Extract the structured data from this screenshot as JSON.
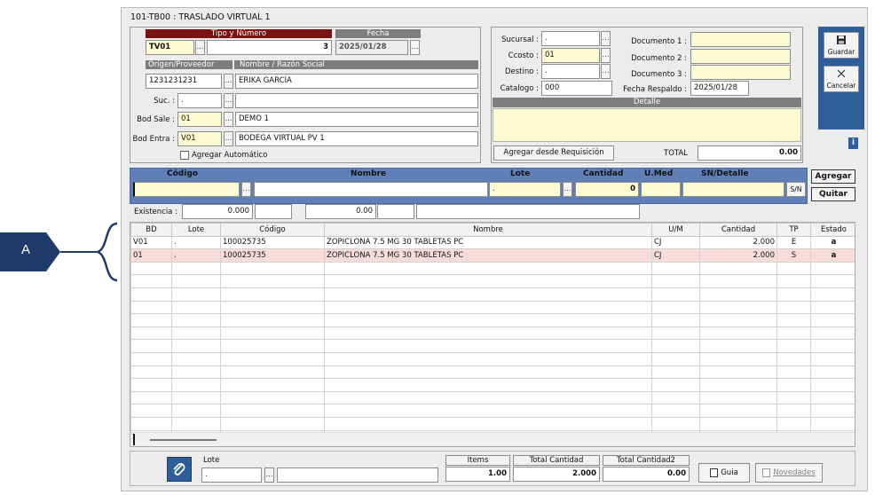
{
  "window_title": "101-TB00 : TRASLADO VIRTUAL 1",
  "callout": "A",
  "header": {
    "tipo_numero_label": "Tipo y Número",
    "fecha_label": "Fecha",
    "tipo": "TV01",
    "numero": "3",
    "fecha": "2025/01/28",
    "origen_label": "Origen/Proveedor",
    "nombre_label": "Nombre / Razón Social",
    "origen": "1231231231",
    "nombre": "ERIKA GARCÍA",
    "suc_label": "Suc. :",
    "suc": ".",
    "bod_sale_label": "Bod Sale :",
    "bod_sale": "01",
    "bod_sale_name": "DEMO 1",
    "bod_entra_label": "Bod Entra :",
    "bod_entra": "V01",
    "bod_entra_name": "BODEGA VIRTUAL PV 1",
    "agregar_auto_label": "Agregar Automático"
  },
  "right_panel": {
    "sucursal_label": "Sucursal :",
    "sucursal": ".",
    "ccosto_label": "Ccosto :",
    "ccosto": "01",
    "destino_label": "Destino :",
    "destino": ".",
    "catalogo_label": "Catalogo :",
    "catalogo": "000",
    "doc1_label": "Documento 1 :",
    "doc2_label": "Documento 2 :",
    "doc3_label": "Documento 3 :",
    "doc1": "",
    "doc2": "",
    "doc3": "",
    "fecha_respaldo_label": "Fecha Respaldo :",
    "fecha_respaldo": "2025/01/28",
    "detalle_label": "Detalle",
    "agregar_req_label": "Agregar desde Requisición",
    "total_label": "TOTAL",
    "total": "0.00"
  },
  "toolbar": {
    "guardar_label": "Guardar",
    "cancelar_label": "Cancelar",
    "info_label": "i"
  },
  "entry": {
    "codigo_label": "Código",
    "nombre_label": "Nombre",
    "lote_label": "Lote",
    "cantidad_label": "Cantidad",
    "umed_label": "U.Med",
    "sn_label": "SN/Detalle",
    "lote": ".",
    "cantidad": "0",
    "sn_btn": "S/N",
    "agregar_label": "Agregar",
    "quitar_label": "Quitar",
    "existencia_label": "Existencia :",
    "existencia1": "0.000",
    "existencia2": "0.00"
  },
  "grid": {
    "columns": [
      "BD",
      "Lote",
      "Código",
      "Nombre",
      "U/M",
      "Cantidad",
      "TP",
      "Estado"
    ],
    "rows": [
      [
        "V01",
        ".",
        "100025735",
        "ZOPICLONA 7.5 MG 30 TABLETAS PC",
        "CJ",
        "2.000",
        "E",
        "a"
      ],
      [
        "01",
        ".",
        "100025735",
        "ZOPICLONA 7.5 MG 30 TABLETAS PC",
        "CJ",
        "2.000",
        "S",
        "a"
      ]
    ]
  },
  "footer": {
    "lote_label": "Lote",
    "lote": ".",
    "items_label": "Items",
    "items": "1.00",
    "total_cantidad_label": "Total Cantidad",
    "total_cantidad": "2.000",
    "total_cantidad2_label": "Total Cantidad2",
    "total_cantidad2": "0.00",
    "guia_label": "Guia",
    "novedades_label": "Novedades"
  },
  "colors": {
    "header_red": "#7a1212",
    "grid_header_blue": "#5f7fb6",
    "toolbar_blue": "#2f5f98",
    "field_yellow": "#fdfbd2",
    "selected_row_pink": "#f8dcdc"
  }
}
